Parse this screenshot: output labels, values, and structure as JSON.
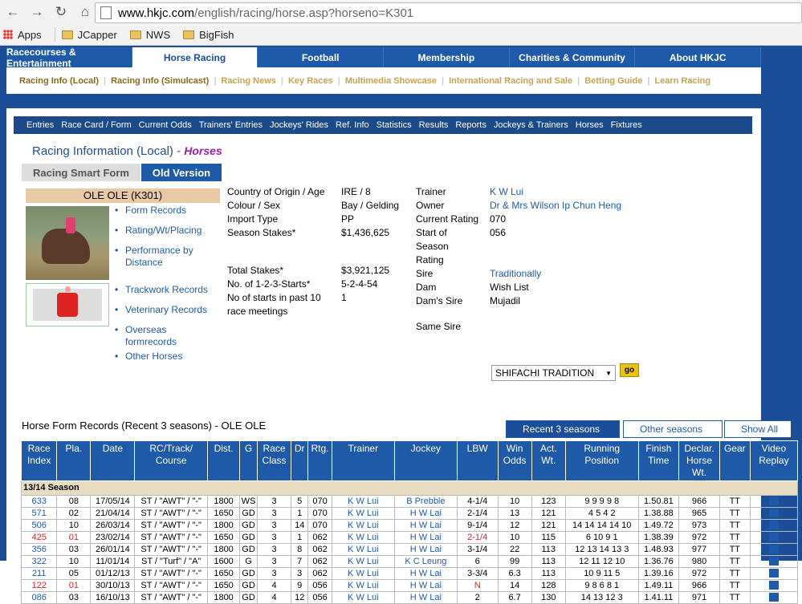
{
  "browser": {
    "url_domain": "www.hkjc.com",
    "url_path": "/english/racing/horse.asp?horseno=K301",
    "bookmarks": [
      "Apps",
      "JCapper",
      "NWS",
      "BigFish"
    ]
  },
  "topnav": [
    "Racecourses & Entertainment",
    "Horse Racing",
    "Football",
    "Membership",
    "Charities & Community",
    "About HKJC"
  ],
  "subnav": [
    "Racing Info (Local)",
    "Racing Info (Simulcast)",
    "Racing News",
    "Key Races",
    "Multimedia Showcase",
    "International Racing and Sale",
    "Betting Guide",
    "Learn Racing"
  ],
  "menu": [
    "Entries",
    "Race Card / Form",
    "Current Odds",
    "Trainers' Entries",
    "Jockeys' Rides",
    "Ref. Info",
    "Statistics",
    "Results",
    "Reports",
    "Jockeys & Trainers",
    "Horses",
    "Fixtures"
  ],
  "header": {
    "title": "Racing Information (Local)",
    "dash": "-",
    "sub": "Horses"
  },
  "buttons": {
    "smart": "Racing Smart Form",
    "old": "Old Version"
  },
  "horse": {
    "name": "OLE OLE  (K301)"
  },
  "links": [
    "Form Records",
    "Rating/Wt/Placing",
    "Performance by Distance",
    "Trackwork Records",
    "Veterinary Records",
    "Overseas formrecords",
    "Other Horses"
  ],
  "info_left": [
    {
      "l": "Country of Origin / Age",
      "v": "IRE / 8"
    },
    {
      "l": "Colour / Sex",
      "v": "Bay / Gelding"
    },
    {
      "l": "Import Type",
      "v": "PP"
    },
    {
      "l": "Season Stakes*",
      "v": "$1,436,625"
    },
    {
      "l": "Total Stakes*",
      "v": "$3,921,125"
    },
    {
      "l": "No. of 1-2-3-Starts*",
      "v": "5-2-4-54"
    },
    {
      "l": "No of starts in past 10 race meetings",
      "v": "1"
    }
  ],
  "info_right": [
    {
      "l": "Trainer",
      "v": "K W Lui"
    },
    {
      "l": "Owner",
      "v": "Dr & Mrs Wilson Ip Chun Heng"
    },
    {
      "l": "Current Rating",
      "v": "070"
    },
    {
      "l": "Start of Season Rating",
      "v": "056"
    },
    {
      "l": "Sire",
      "v": "Traditionally"
    },
    {
      "l": "Dam",
      "v": "Wish List"
    },
    {
      "l": "Dam's Sire",
      "v": "Mujadil"
    },
    {
      "l": "Same Sire",
      "v": "SHIFACHI TRADITION"
    }
  ],
  "go": "go",
  "form_title": "Horse Form Records (Recent 3 seasons) - OLE OLE",
  "tabs": [
    "Recent 3 seasons",
    "Other seasons",
    "Show All"
  ],
  "table": {
    "headers": [
      "Race Index",
      "Pla.",
      "Date",
      "RC/Track/ Course",
      "Dist.",
      "G",
      "Race Class",
      "Dr",
      "Rtg.",
      "Trainer",
      "Jockey",
      "LBW",
      "Win Odds",
      "Act. Wt.",
      "Running Position",
      "Finish Time",
      "Declar. Horse Wt.",
      "Gear",
      "Video Replay"
    ],
    "season": "13/14 Season",
    "rows": [
      [
        "633",
        "08",
        "17/05/14",
        "ST / \"AWT\" / \"-\"",
        "1800",
        "WS",
        "3",
        "5",
        "070",
        "K W Lui",
        "B Prebble",
        "4-1/4",
        "10",
        "123",
        "9 9 9 9 8",
        "1.50.81",
        "966",
        "TT"
      ],
      [
        "571",
        "02",
        "21/04/14",
        "ST / \"AWT\" / \"-\"",
        "1650",
        "GD",
        "3",
        "1",
        "070",
        "K W Lui",
        "H W Lai",
        "2-1/4",
        "13",
        "121",
        "4 5 4 2",
        "1.38.88",
        "965",
        "TT"
      ],
      [
        "506",
        "10",
        "26/03/14",
        "ST / \"AWT\" / \"-\"",
        "1800",
        "GD",
        "3",
        "14",
        "070",
        "K W Lui",
        "H W Lai",
        "9-1/4",
        "12",
        "121",
        "14 14 14 14 10",
        "1.49.72",
        "973",
        "TT"
      ],
      [
        "425",
        "01",
        "23/02/14",
        "ST / \"AWT\" / \"-\"",
        "1650",
        "GD",
        "3",
        "1",
        "062",
        "K W Lui",
        "H W Lai",
        "2-1/4",
        "10",
        "115",
        "6 10 9 1",
        "1.38.39",
        "972",
        "TT"
      ],
      [
        "356",
        "03",
        "26/01/14",
        "ST / \"AWT\" / \"-\"",
        "1800",
        "GD",
        "3",
        "8",
        "062",
        "K W Lui",
        "H W Lai",
        "3-1/4",
        "22",
        "113",
        "12 13 14 13 3",
        "1.48.93",
        "977",
        "TT"
      ],
      [
        "322",
        "10",
        "11/01/14",
        "ST / \"Turf\" / \"A\"",
        "1600",
        "G",
        "3",
        "7",
        "062",
        "K W Lui",
        "K C Leung",
        "6",
        "99",
        "113",
        "12 11 12 10",
        "1.36.76",
        "980",
        "TT"
      ],
      [
        "211",
        "05",
        "01/12/13",
        "ST / \"AWT\" / \"-\"",
        "1650",
        "GD",
        "3",
        "3",
        "062",
        "K W Lui",
        "H W Lai",
        "3-3/4",
        "6.3",
        "113",
        "10 9 11 5",
        "1.39.16",
        "972",
        "TT"
      ],
      [
        "122",
        "01",
        "30/10/13",
        "ST / \"AWT\" / \"-\"",
        "1650",
        "GD",
        "4",
        "9",
        "056",
        "K W Lui",
        "H W Lai",
        "N",
        "14",
        "128",
        "9 8 6 8 1",
        "1.49.11",
        "966",
        "TT"
      ],
      [
        "086",
        "03",
        "16/10/13",
        "ST / \"AWT\" / \"-\"",
        "1800",
        "GD",
        "4",
        "12",
        "056",
        "K W Lui",
        "H W Lai",
        "2",
        "6.7",
        "130",
        "14 13 12 3",
        "1.41.11",
        "971",
        "TT"
      ]
    ],
    "winner_rows": [
      3,
      7
    ]
  }
}
